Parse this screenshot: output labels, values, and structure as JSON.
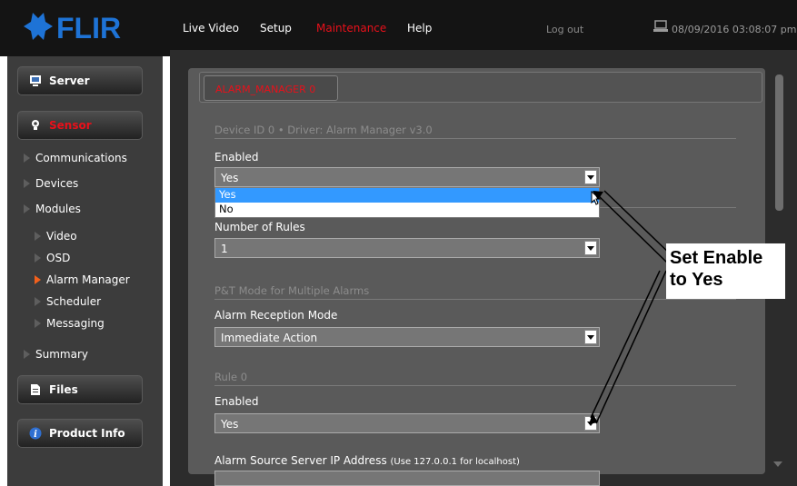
{
  "logo": {
    "text": "FLIR"
  },
  "nav": {
    "items": [
      "Live Video",
      "Setup",
      "Maintenance",
      "Help"
    ],
    "active": "Maintenance",
    "logout": "Log out",
    "datetime": "08/09/2016 03:08:07 pm"
  },
  "sidebar": {
    "server": "Server",
    "sensor": "Sensor",
    "communications": "Communications",
    "devices": "Devices",
    "modules": "Modules",
    "video": "Video",
    "osd": "OSD",
    "alarm_manager": "Alarm Manager",
    "scheduler": "Scheduler",
    "messaging": "Messaging",
    "summary": "Summary",
    "files": "Files",
    "product_info": "Product Info"
  },
  "main": {
    "tab": "ALARM_MANAGER 0",
    "device_header": "Device ID 0  •  Driver: Alarm Manager v3.0",
    "enabled_label": "Enabled",
    "enabled_value": "Yes",
    "enabled_options": [
      "Yes",
      "No"
    ],
    "rules_label": "Number of Rules",
    "rules_value": "1",
    "pt_header": "P&T Mode for Multiple Alarms",
    "reception_label": "Alarm Reception Mode",
    "reception_value": "Immediate Action",
    "rule_header": "Rule 0",
    "rule_enabled_label": "Enabled",
    "rule_enabled_value": "Yes",
    "ip_label": "Alarm Source Server IP Address",
    "ip_hint": "(Use 127.0.0.1 for localhost)"
  },
  "callout": {
    "line1": "Set Enable",
    "line2": "to Yes"
  },
  "colors": {
    "topbar": "#141414",
    "accent_red": "#e8101a",
    "active_arrow": "#f2601c",
    "dropdown_highlight": "#3399ff",
    "panel": "#5a5a5a"
  },
  "icons": {
    "logo": "flir-star-logo",
    "clock": "laptop-icon",
    "server": "server-icon",
    "sensor": "camera-icon",
    "files": "document-icon",
    "info": "info-icon"
  }
}
